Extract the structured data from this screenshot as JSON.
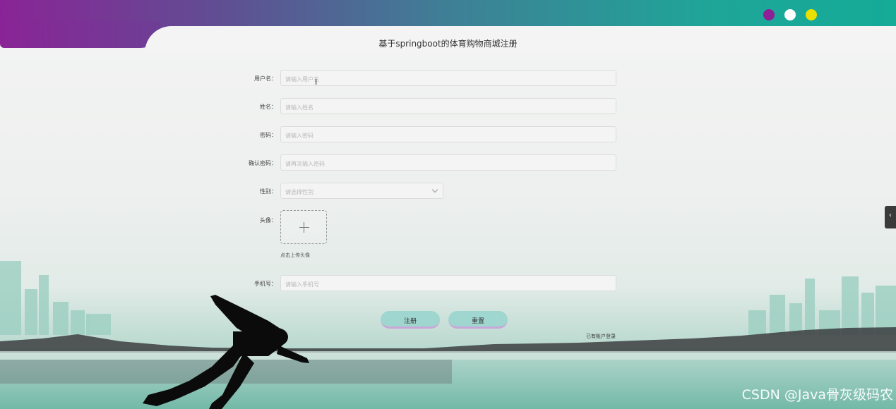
{
  "header": {
    "dots": [
      "#8e1f96",
      "#ffffff",
      "#e9e000"
    ],
    "gradient_start": "#8a2496",
    "gradient_end": "#14ab97"
  },
  "page_title": "基于springboot的体育购物商城注册",
  "form": {
    "username": {
      "label": "用户名：",
      "placeholder": "请输入用户名"
    },
    "name": {
      "label": "姓名：",
      "placeholder": "请输入姓名"
    },
    "password": {
      "label": "密码：",
      "placeholder": "请输入密码"
    },
    "confirm_password": {
      "label": "确认密码：",
      "placeholder": "请再次输入密码"
    },
    "gender": {
      "label": "性别：",
      "placeholder": "请选择性别"
    },
    "avatar": {
      "label": "头像：",
      "hint": "点击上传头像"
    },
    "phone": {
      "label": "手机号：",
      "placeholder": "请输入手机号"
    }
  },
  "buttons": {
    "register": "注册",
    "reset": "重置"
  },
  "login_link": "已有账户登录",
  "side_tab_icon": "chevron-left-icon",
  "watermark": "CSDN @Java骨灰级码农"
}
